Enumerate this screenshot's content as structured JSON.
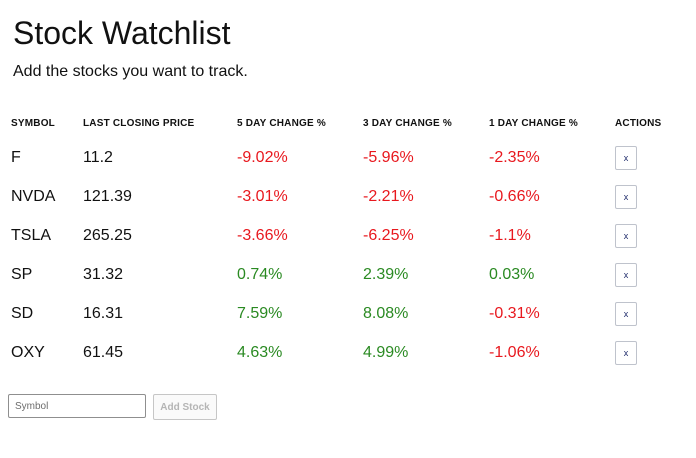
{
  "header": {
    "title": "Stock Watchlist",
    "subtitle": "Add the stocks you want to track."
  },
  "table": {
    "columns": [
      "SYMBOL",
      "LAST CLOSING PRICE",
      "5 DAY CHANGE %",
      "3 DAY CHANGE %",
      "1 DAY CHANGE %",
      "ACTIONS"
    ],
    "rows": [
      {
        "symbol": "F",
        "price": "11.2",
        "d5": "-9.02%",
        "d3": "-5.96%",
        "d1": "-2.35%",
        "remove": "x"
      },
      {
        "symbol": "NVDA",
        "price": "121.39",
        "d5": "-3.01%",
        "d3": "-2.21%",
        "d1": "-0.66%",
        "remove": "x"
      },
      {
        "symbol": "TSLA",
        "price": "265.25",
        "d5": "-3.66%",
        "d3": "-6.25%",
        "d1": "-1.1%",
        "remove": "x"
      },
      {
        "symbol": "SP",
        "price": "31.32",
        "d5": "0.74%",
        "d3": "2.39%",
        "d1": "0.03%",
        "remove": "x"
      },
      {
        "symbol": "SD",
        "price": "16.31",
        "d5": "7.59%",
        "d3": "8.08%",
        "d1": "-0.31%",
        "remove": "x"
      },
      {
        "symbol": "OXY",
        "price": "61.45",
        "d5": "4.63%",
        "d3": "4.99%",
        "d1": "-1.06%",
        "remove": "x"
      }
    ]
  },
  "form": {
    "symbol_placeholder": "Symbol",
    "symbol_value": "",
    "add_label": "Add Stock"
  },
  "colors": {
    "positive": "#2a8a22",
    "negative": "#e8181e",
    "remove_icon": "#1e2a6a"
  }
}
